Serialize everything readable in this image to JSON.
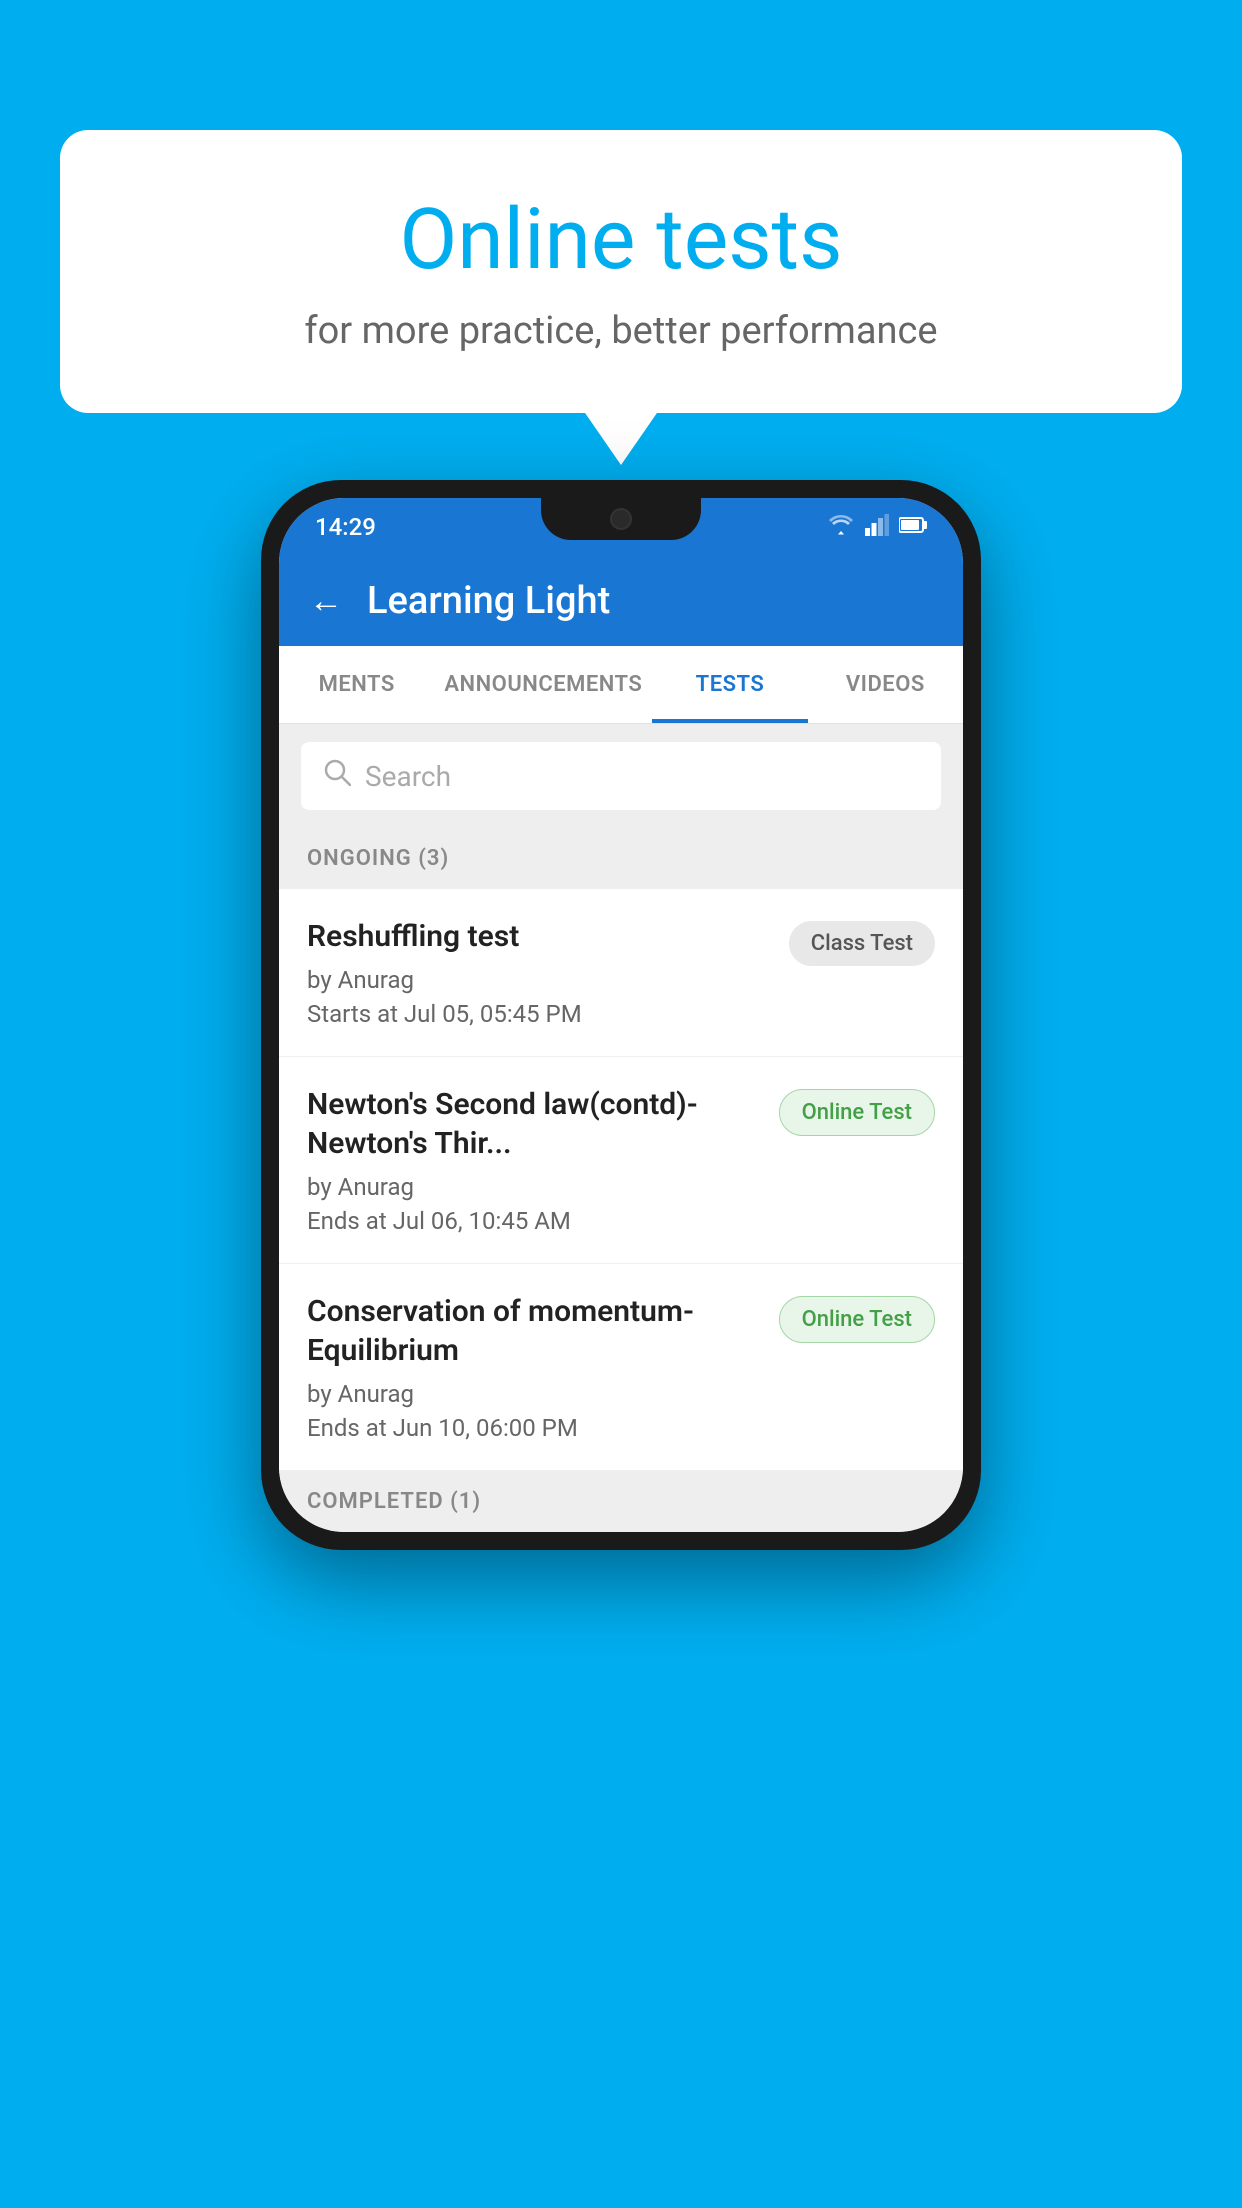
{
  "background": {
    "color": "#00AEEF"
  },
  "speech_bubble": {
    "title": "Online tests",
    "subtitle": "for more practice, better performance"
  },
  "phone": {
    "status_bar": {
      "time": "14:29",
      "wifi": "▼",
      "signal": "▲",
      "battery": "▮"
    },
    "header": {
      "back_label": "←",
      "title": "Learning Light"
    },
    "tabs": [
      {
        "label": "MENTS",
        "active": false
      },
      {
        "label": "ANNOUNCEMENTS",
        "active": false
      },
      {
        "label": "TESTS",
        "active": true
      },
      {
        "label": "VIDEOS",
        "active": false
      }
    ],
    "search": {
      "placeholder": "Search"
    },
    "ongoing_section": {
      "label": "ONGOING (3)"
    },
    "tests": [
      {
        "title": "Reshuffling test",
        "author": "by Anurag",
        "date": "Starts at  Jul 05, 05:45 PM",
        "badge": "Class Test",
        "badge_type": "class"
      },
      {
        "title": "Newton's Second law(contd)-Newton's Thir...",
        "author": "by Anurag",
        "date": "Ends at  Jul 06, 10:45 AM",
        "badge": "Online Test",
        "badge_type": "online"
      },
      {
        "title": "Conservation of momentum-Equilibrium",
        "author": "by Anurag",
        "date": "Ends at  Jun 10, 06:00 PM",
        "badge": "Online Test",
        "badge_type": "online"
      }
    ],
    "completed_section": {
      "label": "COMPLETED (1)"
    }
  }
}
